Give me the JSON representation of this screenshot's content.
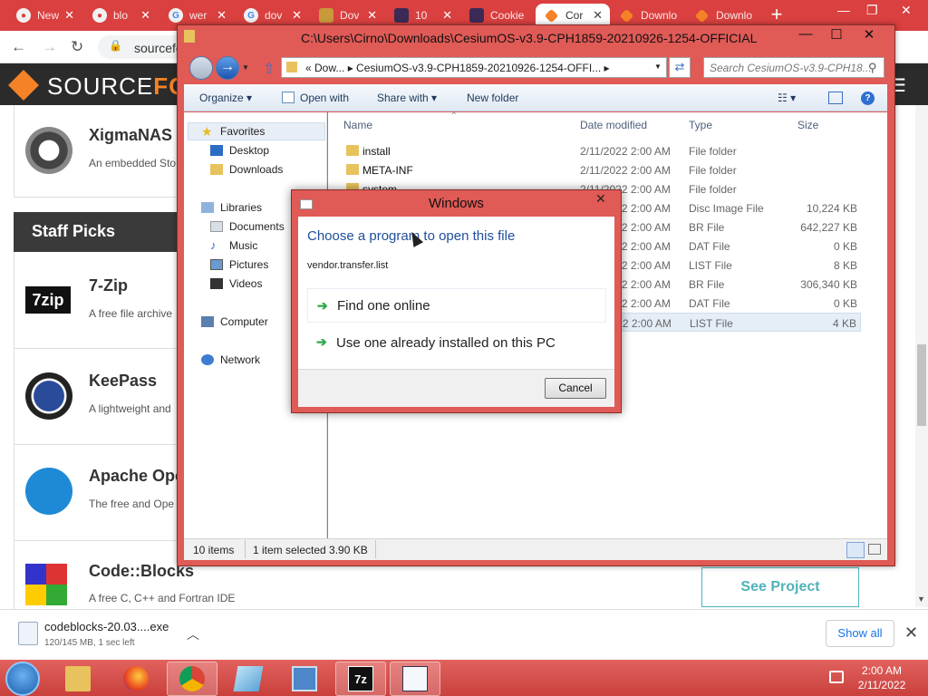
{
  "browser": {
    "tabs": [
      {
        "label": "New",
        "icon": "github-icon"
      },
      {
        "label": "blo",
        "icon": "github-icon"
      },
      {
        "label": "wer",
        "icon": "google-icon"
      },
      {
        "label": "dov",
        "icon": "google-icon"
      },
      {
        "label": "Dov",
        "icon": "download-site-icon"
      },
      {
        "label": "10",
        "icon": "site-icon"
      },
      {
        "label": "Cookie",
        "icon": "site-icon"
      },
      {
        "label": "Cor",
        "icon": "sourceforge-icon"
      },
      {
        "label": "Downlo",
        "icon": "sourceforge-icon"
      },
      {
        "label": "Downlo",
        "icon": "sourceforge-icon"
      }
    ],
    "address": "sourcefo",
    "new_tab": "+",
    "win_min": "—",
    "win_max": "❐",
    "win_close": "✕"
  },
  "sourceforge": {
    "logo_source": "SOURCE",
    "logo_forge": "FOR",
    "items": [
      {
        "name": "XigmaNAS",
        "desc": "An embedded Sto"
      },
      {
        "name": "7-Zip",
        "desc": "A free file archive"
      },
      {
        "name": "KeePass",
        "desc": "A lightweight and"
      },
      {
        "name": "Apache Ope",
        "desc": "The free and Ope"
      },
      {
        "name": "Code::Blocks",
        "desc": "A free C, C++ and Fortran IDE"
      }
    ],
    "staff_picks": "Staff Picks",
    "see_project": "See Project"
  },
  "download_bar": {
    "file": "codeblocks-20.03....exe",
    "status": "120/145 MB, 1 sec left",
    "show_all": "Show all"
  },
  "explorer": {
    "title": "C:\\Users\\Cirno\\Downloads\\CesiumOS-v3.9-CPH1859-20210926-1254-OFFICIAL",
    "breadcrumb": "«  Dow...  ▸  CesiumOS-v3.9-CPH1859-20210926-1254-OFFI...  ▸",
    "search_placeholder": "Search CesiumOS-v3.9-CPH18...",
    "toolbar": {
      "organize": "Organize ▾",
      "open_with": "Open with",
      "share_with": "Share with ▾",
      "new_folder": "New folder"
    },
    "nav": {
      "favorites": "Favorites",
      "desktop": "Desktop",
      "downloads": "Downloads",
      "libraries": "Libraries",
      "documents": "Documents",
      "music": "Music",
      "pictures": "Pictures",
      "videos": "Videos",
      "computer": "Computer",
      "network": "Network"
    },
    "columns": {
      "name": "Name",
      "date": "Date modified",
      "type": "Type",
      "size": "Size"
    },
    "files": [
      {
        "name": "install",
        "date": "2/11/2022 2:00 AM",
        "type": "File folder",
        "size": ""
      },
      {
        "name": "META-INF",
        "date": "2/11/2022 2:00 AM",
        "type": "File folder",
        "size": ""
      },
      {
        "name": "system",
        "date": "2/11/2022 2:00 AM",
        "type": "File folder",
        "size": ""
      },
      {
        "name": "",
        "date": "2/11/2022 2:00 AM",
        "type": "Disc Image File",
        "size": "10,224 KB"
      },
      {
        "name": "",
        "date": "2/11/2022 2:00 AM",
        "type": "BR File",
        "size": "642,227 KB"
      },
      {
        "name": "",
        "date": "2/11/2022 2:00 AM",
        "type": "DAT File",
        "size": "0 KB"
      },
      {
        "name": "",
        "date": "2/11/2022 2:00 AM",
        "type": "LIST File",
        "size": "8 KB"
      },
      {
        "name": "",
        "date": "2/11/2022 2:00 AM",
        "type": "BR File",
        "size": "306,340 KB"
      },
      {
        "name": "",
        "date": "2/11/2022 2:00 AM",
        "type": "DAT File",
        "size": "0 KB"
      },
      {
        "name": "",
        "date": "2/11/2022 2:00 AM",
        "type": "LIST File",
        "size": "4 KB"
      }
    ],
    "status": {
      "count": "10 items",
      "selected": "1 item selected  3.90 KB"
    }
  },
  "dialog": {
    "title": "Windows",
    "heading": "Choose a program to open this file",
    "filename": "vendor.transfer.list",
    "options": [
      "Find one online",
      "Use one already installed on this PC"
    ],
    "cancel": "Cancel"
  },
  "taskbar": {
    "time": "2:00 AM",
    "date": "2/11/2022",
    "apps": [
      "start-orb",
      "explorer",
      "firefox",
      "chrome",
      "notepad-tool",
      "control-panel",
      "7zip",
      "checklist-app"
    ]
  },
  "colors": {
    "accent": "#d9403f",
    "sourceforge_orange": "#f58226",
    "link_blue": "#1a73e8"
  }
}
